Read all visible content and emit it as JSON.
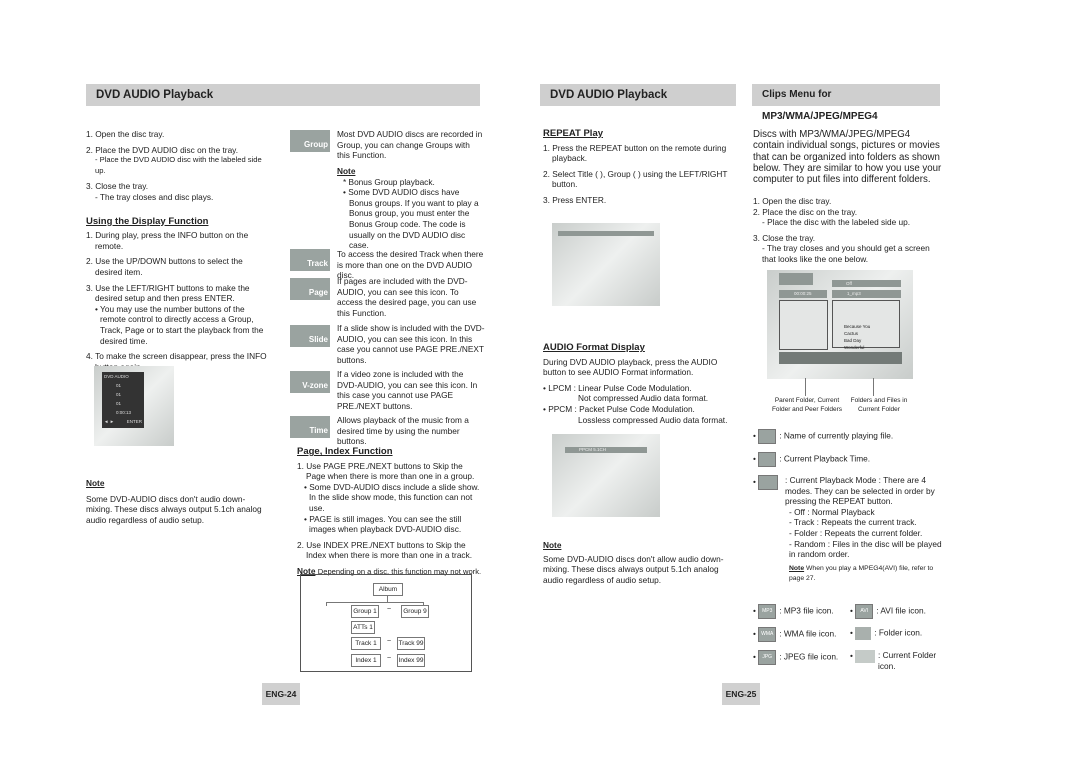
{
  "left_page": {
    "header": "DVD AUDIO Playback",
    "steps": [
      "1. Open the disc tray.",
      "2. Place the DVD AUDIO disc on the tray.",
      "- Place the DVD AUDIO disc with the labeled side up.",
      "3. Close the tray.",
      "- The tray closes and disc plays."
    ],
    "display_function": {
      "title": "Using the Display Function",
      "items": [
        "1. During play, press the INFO button on the remote.",
        "2. Use the UP/DOWN buttons to select the desired item.",
        "3. Use the LEFT/RIGHT buttons to make the desired setup and then press ENTER.",
        "• You may use the number buttons of the remote control to directly access a Group, Track, Page or to start the playback from the desired time.",
        "4. To make the screen disappear, press the INFO button again."
      ]
    },
    "osd": {
      "title": "DVD AUDIO",
      "rows": [
        "01",
        "01",
        "01",
        "0:00:13"
      ],
      "footer_left": "◄ ►",
      "footer_right": "ENTER"
    },
    "note": {
      "label": "Note",
      "text": "Some DVD-AUDIO discs don't audio down-mixing. These discs always output 5.1ch analog audio regardless of audio setup."
    },
    "icons": [
      {
        "label": "Group",
        "text": "Most DVD AUDIO discs are recorded in Group, you can change Groups with this Function."
      },
      {
        "label": "Track",
        "text": "To access the desired Track when there is more than one on the DVD AUDIO disc."
      },
      {
        "label": "Page",
        "text": "If pages are included with the DVD-AUDIO, you can see this icon. To access the desired page, you can use this Function."
      },
      {
        "label": "Slide",
        "text": "If a slide show is included with the DVD-AUDIO, you can see this icon. In this case you cannot use PAGE PRE./NEXT buttons."
      },
      {
        "label": "V-zone",
        "text": "If a video zone is included with the DVD-AUDIO, you can see this icon. In this case you cannot use PAGE PRE./NEXT buttons."
      },
      {
        "label": "Time",
        "text": "Allows playback of the music from a desired time by using the number buttons."
      }
    ],
    "group_note": {
      "label": "Note",
      "lines": [
        "* Bonus Group playback.",
        "• Some DVD AUDIO discs have Bonus groups. If you want to play a Bonus group, you must enter the Bonus Group code. The code is usually on the DVD AUDIO disc case."
      ]
    },
    "page_index": {
      "title": "Page, Index Function",
      "items": [
        "1. Use PAGE PRE./NEXT buttons to Skip the Page when there is more than one in a group.",
        "• Some DVD-AUDIO discs include a slide show. In the slide show mode, this function can not use.",
        "• PAGE is still images. You can see the still images when playback DVD-AUDIO disc.",
        "2. Use INDEX PRE./NEXT buttons to Skip the Index when there is more than one in a track."
      ],
      "note_label": "Note",
      "note_text": "Depending on a disc, this function may not work."
    },
    "tree": {
      "album": "Album",
      "group1": "Group 1",
      "group9": "Group 9",
      "atts": "ATTs 1",
      "track1": "Track 1",
      "track99": "Track 99",
      "index1": "Index 1",
      "index99": "Index 99",
      "tilde": "~"
    },
    "page_number": "ENG-24"
  },
  "middle": {
    "header": "DVD AUDIO Playback",
    "repeat": {
      "title": "REPEAT Play",
      "items": [
        "1. Press the REPEAT button on the remote during playback.",
        "2. Select Title ( ), Group ( ) using the LEFT/RIGHT button.",
        "3. Press ENTER."
      ]
    },
    "audio_format": {
      "title": "AUDIO Format Display",
      "intro": "During DVD AUDIO playback, press the AUDIO button to see AUDIO Format information.",
      "lpcm": "• LPCM : Linear Pulse Code Modulation.",
      "lpcm2": "Not compressed Audio data format.",
      "ppcm": "• PPCM : Packet Pulse Code Modulation.",
      "ppcm2": "Lossless compressed Audio data format.",
      "osd": "PPCM 5.1CH"
    },
    "note": {
      "label": "Note",
      "text": "Some DVD-AUDIO discs don't allow audio down-mixing. These discs always output 5.1ch analog audio regardless of audio setup."
    }
  },
  "right_page": {
    "header": "Clips Menu for MP3/WMA/JPEG/MPEG4",
    "intro": "Discs with MP3/WMA/JPEG/MPEG4 contain individual songs, pictures or movies that can be organized into folders as shown below. They are similar to how you use your computer to put files into different folders.",
    "steps": [
      "1. Open the disc tray.",
      "2. Place the disc on the tray.",
      "- Place the disc with the labeled side up.",
      "3. Close the tray.",
      "- The tray closes and you should get a screen that looks like the one below."
    ],
    "screen": {
      "top": "Off",
      "time": "00:00:25",
      "file": "1_mp3",
      "files": [
        "Because You",
        "Cactus",
        "Bad Day",
        "Wonderful"
      ]
    },
    "caption_left": "Parent Folder, Current Folder and Peer Folders",
    "caption_right": "Folders and Files in Current Folder",
    "bullets": [
      ": Name of currently playing file.",
      ": Current Playback Time.",
      ": Current Playback Mode : There are 4 modes. They can be selected in order by pressing the REPEAT button."
    ],
    "modes": [
      "- Off : Normal Playback",
      "- Track : Repeats the current track.",
      "- Folder : Repeats the current folder.",
      "- Random : Files in the disc will be played in random order."
    ],
    "note_label": "Note",
    "note_text": "When you play a MPEG4(AVI) file, refer to page 27.",
    "file_icons": [
      {
        "icon": "MP3",
        "text": ": MP3 file icon."
      },
      {
        "icon": "AVI",
        "text": ": AVI file icon."
      },
      {
        "icon": "WMA",
        "text": ": WMA file icon."
      },
      {
        "icon": "",
        "text": ": Folder icon."
      },
      {
        "icon": "JPG",
        "text": ": JPEG file icon."
      },
      {
        "icon": "",
        "text": ": Current Folder icon."
      }
    ],
    "page_number": "ENG-25"
  }
}
